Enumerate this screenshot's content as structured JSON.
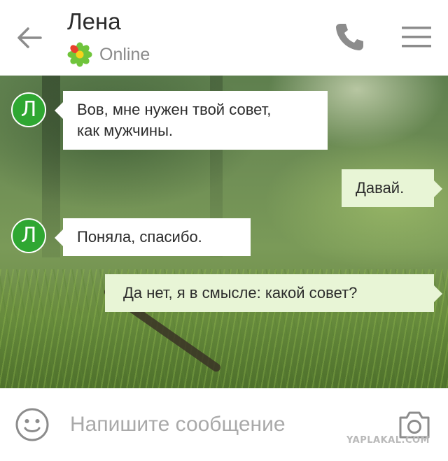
{
  "header": {
    "contact_name": "Лена",
    "status": "Online",
    "icons": {
      "back": "arrow-left-icon",
      "status": "icq-flower-icon",
      "call": "phone-icon",
      "menu": "hamburger-menu-icon"
    }
  },
  "messages": [
    {
      "direction": "in",
      "avatar_letter": "Л",
      "lines": [
        "Вов, мне нужен твой совет,",
        "как мужчины."
      ]
    },
    {
      "direction": "out",
      "lines": [
        "Давай."
      ]
    },
    {
      "direction": "in",
      "avatar_letter": "Л",
      "lines": [
        "Поняла, спасибо."
      ]
    },
    {
      "direction": "out",
      "lines": [
        "Да нет, я в смысле: какой совет?"
      ]
    }
  ],
  "composer": {
    "placeholder": "Напишите сообщение",
    "value": "",
    "icons": {
      "emoji": "smiley-icon",
      "camera": "camera-icon"
    }
  },
  "watermark": "YAPLAKAL.COM",
  "colors": {
    "avatar": "#2fa732",
    "incoming_bubble": "#ffffff",
    "outgoing_bubble": "#e8f5d6",
    "icon_gray": "#8c8c8c",
    "text_dark": "#2b2b2b",
    "status_gray": "#8a8a8a"
  }
}
